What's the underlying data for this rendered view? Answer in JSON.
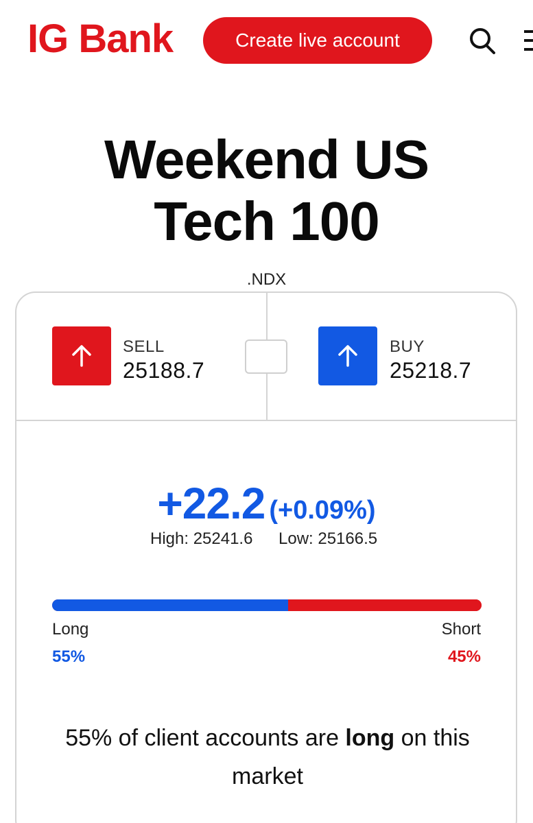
{
  "header": {
    "logo": "IG Bank",
    "cta_label": "Create live account"
  },
  "market": {
    "title_line1": "Weekend US",
    "title_line2": "Tech 100",
    "ticker": ".NDX"
  },
  "prices": {
    "sell_label": "SELL",
    "sell_value": "25188.7",
    "buy_label": "BUY",
    "buy_value": "25218.7"
  },
  "change": {
    "value": "+22.2",
    "percent": "(+0.09%)",
    "high": "High: 25241.6",
    "low": "Low: 25166.5"
  },
  "sentiment": {
    "long_label": "Long",
    "long_pct": "55%",
    "long_value": 55,
    "short_label": "Short",
    "short_pct": "45%",
    "short_value": 45,
    "summary_prefix": "55% of client accounts are ",
    "summary_bold": "long",
    "summary_suffix": " on this market"
  },
  "colors": {
    "brand_red": "#e0161d",
    "buy_blue": "#1259e3"
  },
  "icons": {
    "search": "search-icon",
    "sell_arrow": "arrow-up-icon",
    "buy_arrow": "arrow-up-icon"
  }
}
